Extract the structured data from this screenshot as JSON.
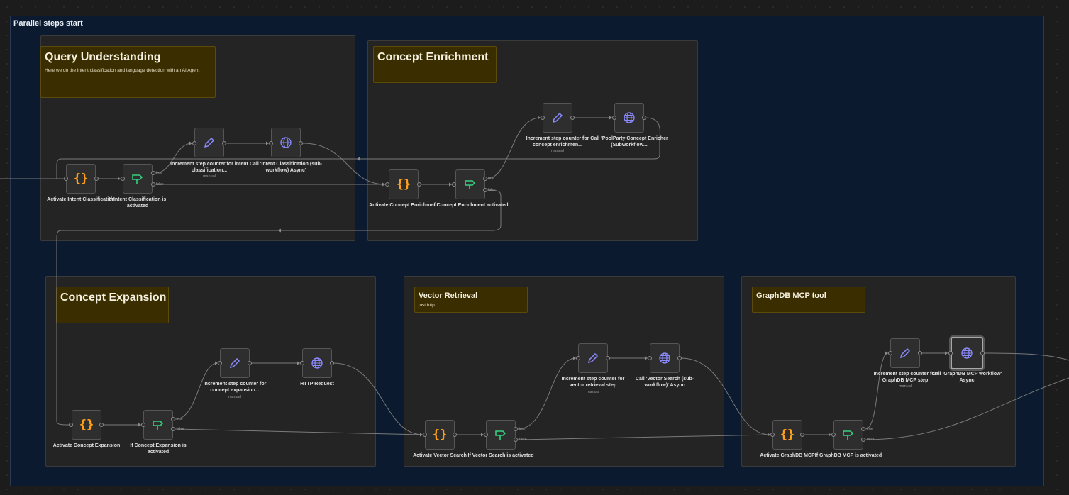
{
  "canvas": {
    "group_title": "Parallel steps start"
  },
  "sections": {
    "query_understanding": {
      "title": "Query Understanding",
      "description": "Here we do the intent classification and language detection with an AI Agent"
    },
    "concept_enrichment": {
      "title": "Concept Enrichment"
    },
    "concept_expansion": {
      "title": "Concept Expansion"
    },
    "vector_retrieval": {
      "title": "Vector Retrieval",
      "description": "just http"
    },
    "graphdb_mcp": {
      "title": "GraphDB MCP tool"
    }
  },
  "nodes": {
    "activate_intent": {
      "label": "Activate Intent Classification",
      "icon": "code-braces-icon"
    },
    "if_intent": {
      "label": "If Intent Classification is activated",
      "icon": "signpost-icon"
    },
    "inc_intent": {
      "label": "Increment step counter for intent classification...",
      "sub": "manual",
      "icon": "pencil-icon"
    },
    "call_intent": {
      "label": "Call 'Intent Classification (sub-workflow) Async'",
      "icon": "globe-icon"
    },
    "activate_enrich": {
      "label": "Activate Concept Enrichment",
      "icon": "code-braces-icon"
    },
    "if_enrich": {
      "label": "If Concept Enrichment activated",
      "icon": "signpost-icon"
    },
    "inc_enrich": {
      "label": "Increment step counter for concept enrichmen...",
      "sub": "manual",
      "icon": "pencil-icon"
    },
    "call_enrich": {
      "label": "Call 'PoolParty Concept Enricher (Subworkflow...",
      "icon": "globe-icon"
    },
    "activate_expansion": {
      "label": "Activate Concept Expansion",
      "icon": "code-braces-icon"
    },
    "if_expansion": {
      "label": "If Concept Expansion is activated",
      "icon": "signpost-icon"
    },
    "inc_expansion": {
      "label": "Increment step counter for concept expansion...",
      "sub": "manual",
      "icon": "pencil-icon"
    },
    "http_request": {
      "label": "HTTP Request",
      "icon": "globe-icon"
    },
    "activate_vector": {
      "label": "Activate Vector Search",
      "icon": "code-braces-icon"
    },
    "if_vector": {
      "label": "If Vector Search is activated",
      "icon": "signpost-icon"
    },
    "inc_vector": {
      "label": "Increment step counter for vector retrieval step",
      "sub": "manual",
      "icon": "pencil-icon"
    },
    "call_vector": {
      "label": "Call 'Vector Search (sub-workflow)' Async",
      "icon": "globe-icon"
    },
    "activate_graphdb": {
      "label": "Activate GraphDB MCP",
      "icon": "code-braces-icon"
    },
    "if_graphdb": {
      "label": "If GraphDB MCP is activated",
      "icon": "signpost-icon"
    },
    "inc_graphdb": {
      "label": "Increment step counter for GraphDB MCP step",
      "sub": "manual",
      "icon": "pencil-icon"
    },
    "call_graphdb": {
      "label": "Call 'GraphDB MCP workflow' Async",
      "icon": "globe-icon"
    }
  },
  "branch_labels": {
    "true": "true",
    "false": "false"
  },
  "colors": {
    "code_icon": "#ff9f1a",
    "if_icon": "#35d07f",
    "pencil_icon": "#8b8bff",
    "globe_icon": "#8b8bff",
    "sticky_bg": "#3a2e00",
    "group_bg": "#0b1a2e"
  }
}
